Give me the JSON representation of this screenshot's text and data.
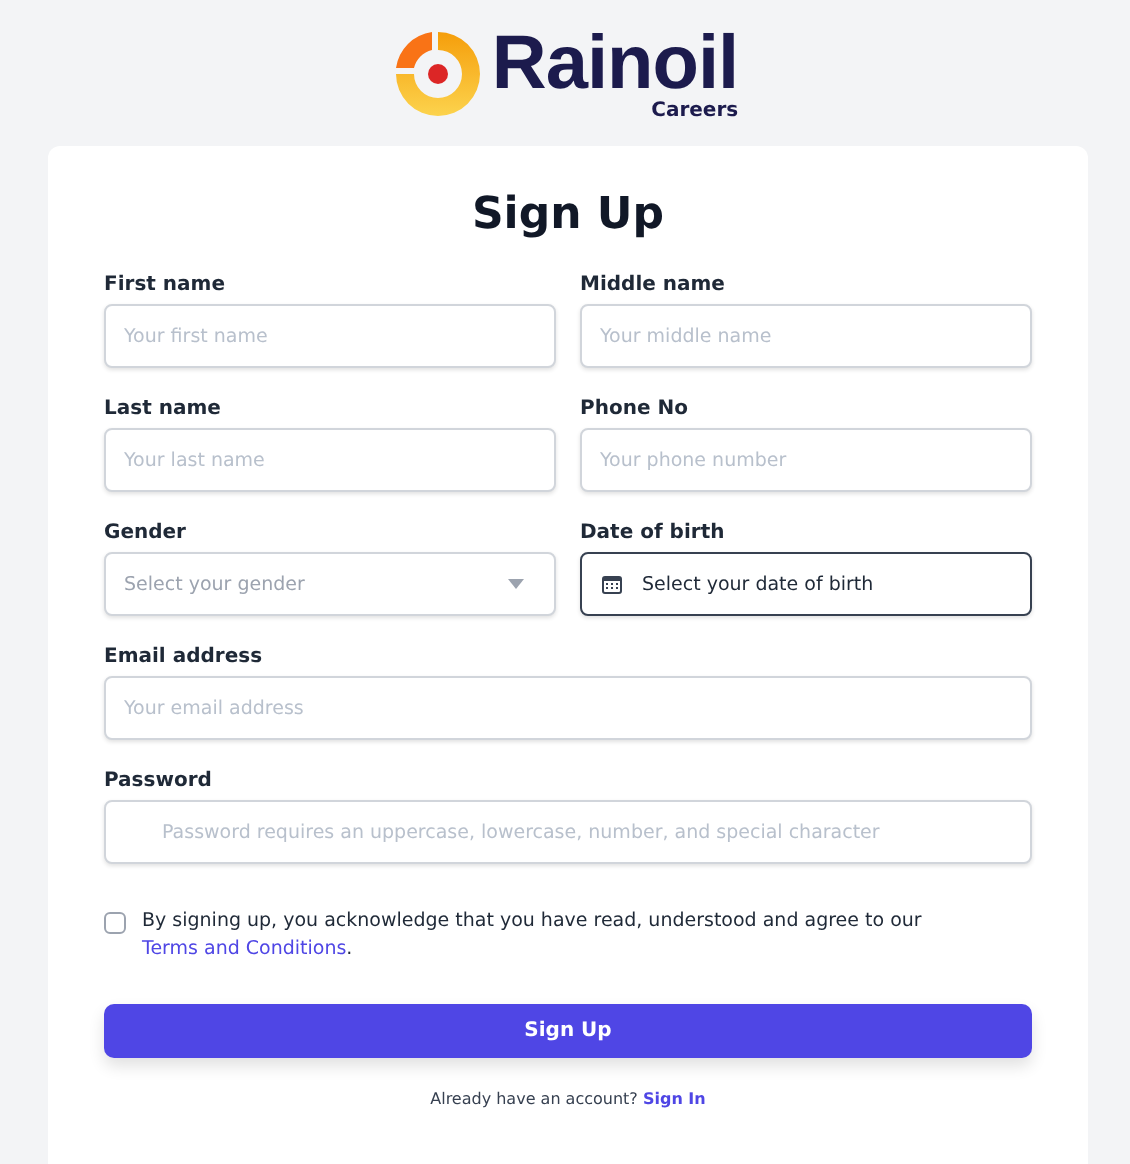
{
  "logo": {
    "name": "Rainoil",
    "subtitle": "Careers"
  },
  "form": {
    "title": "Sign Up",
    "fields": [
      {
        "label": "First name",
        "kind": "text",
        "placeholder": "Your first name",
        "focused": false
      },
      {
        "label": "Middle name",
        "kind": "text",
        "placeholder": "Your middle name",
        "focused": false
      },
      {
        "label": "Last name",
        "kind": "text",
        "placeholder": "Your last name",
        "focused": false
      },
      {
        "label": "Phone No",
        "kind": "text",
        "placeholder": "Your phone number",
        "focused": false
      },
      {
        "label": "Gender",
        "kind": "select",
        "placeholder": "Select your gender",
        "focused": false
      },
      {
        "label": "Date of birth",
        "kind": "date",
        "placeholder": "Select your date of birth",
        "focused": true
      },
      {
        "label": "Email address",
        "kind": "email",
        "placeholder": "Your email address",
        "focused": false
      },
      {
        "label": "Password",
        "kind": "password",
        "placeholder": "Password requires an uppercase, lowercase, number, and special character",
        "focused": false
      }
    ],
    "agreement": {
      "checked": false,
      "text": "By signing up, you acknowledge that you have read, understood and agree to our",
      "link": "Terms and Conditions",
      "after": "."
    },
    "submit": "Sign Up",
    "footer": {
      "text": "Already have an account?",
      "link": "Sign In"
    }
  }
}
